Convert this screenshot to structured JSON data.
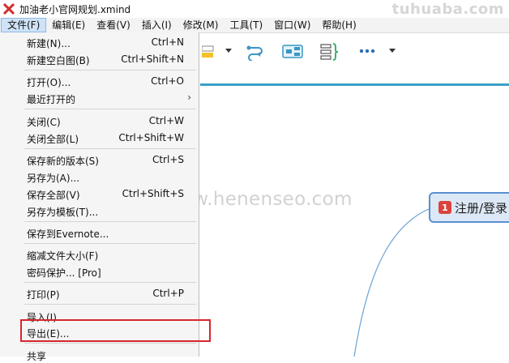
{
  "titlebar": {
    "title": "加油老小官网规划.xmind",
    "watermark": "tuhuaba.com"
  },
  "menubar": {
    "items": [
      "文件(F)",
      "编辑(E)",
      "查看(V)",
      "插入(I)",
      "修改(M)",
      "工具(T)",
      "窗口(W)",
      "帮助(H)"
    ]
  },
  "file_menu": {
    "items": [
      {
        "label": "新建(N)...",
        "shortcut": "Ctrl+N"
      },
      {
        "label": "新建空白图(B)",
        "shortcut": "Ctrl+Shift+N"
      },
      {
        "label": "打开(O)...",
        "shortcut": "Ctrl+O"
      },
      {
        "label": "最近打开的",
        "shortcut": "",
        "submenu": true
      },
      {
        "label": "关闭(C)",
        "shortcut": "Ctrl+W"
      },
      {
        "label": "关闭全部(L)",
        "shortcut": "Ctrl+Shift+W"
      },
      {
        "label": "保存新的版本(S)",
        "shortcut": "Ctrl+S"
      },
      {
        "label": "另存为(A)...",
        "shortcut": ""
      },
      {
        "label": "保存全部(V)",
        "shortcut": "Ctrl+Shift+S"
      },
      {
        "label": "另存为模板(T)...",
        "shortcut": ""
      },
      {
        "label": "保存到Evernote...",
        "shortcut": ""
      },
      {
        "label": "缩减文件大小(F)",
        "shortcut": ""
      },
      {
        "label": "密码保护... [Pro]",
        "shortcut": ""
      },
      {
        "label": "打印(P)",
        "shortcut": "Ctrl+P"
      },
      {
        "label": "导入(I)...",
        "shortcut": ""
      },
      {
        "label": "导出(E)...",
        "shortcut": ""
      },
      {
        "label": "共享",
        "shortcut": ""
      }
    ]
  },
  "canvas": {
    "watermark": "www.henenseo.com",
    "topic": {
      "badge": "1",
      "label": "注册/登录"
    }
  },
  "colors": {
    "accent_line": "#3aa0c8",
    "highlight": "#d8262c",
    "topic_border": "#5a8fd0"
  }
}
